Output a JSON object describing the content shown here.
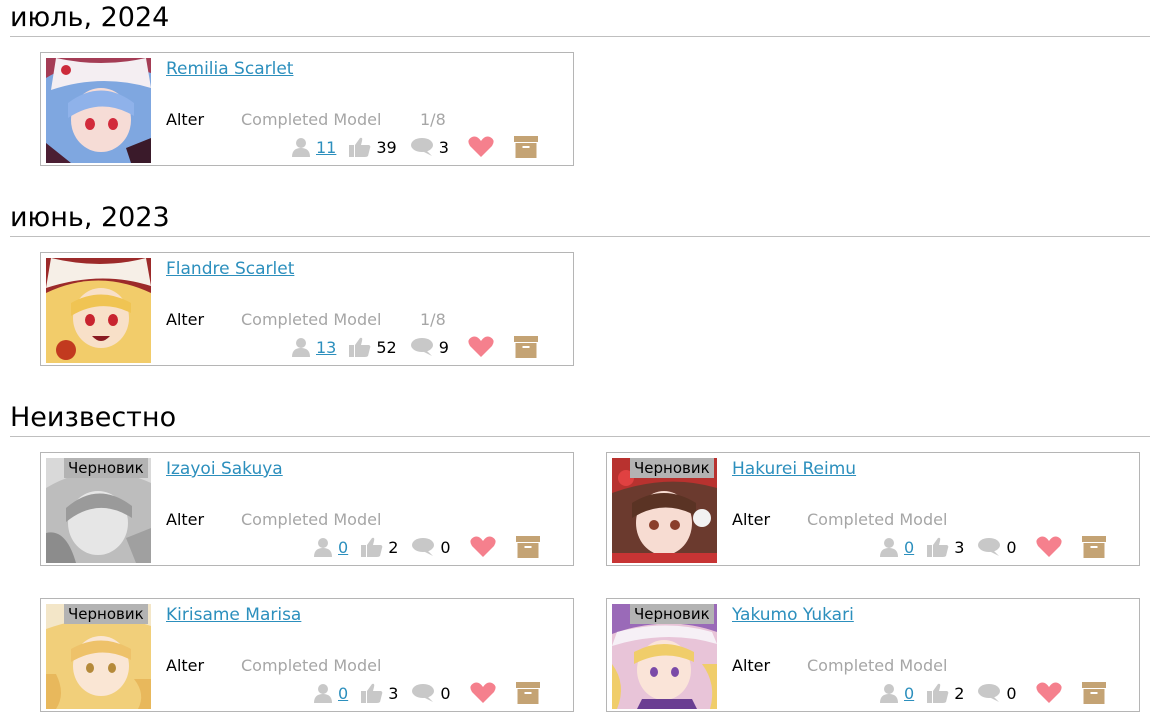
{
  "sections": [
    {
      "title": "июль, 2024"
    },
    {
      "title": "июнь, 2023"
    },
    {
      "title": "Неизвестно"
    }
  ],
  "items": [
    {
      "title": "Remilia Scarlet",
      "maker": "Alter",
      "type": "Completed Model",
      "scale": "1/8",
      "owners": "11",
      "likes": "39",
      "comments": "3",
      "draft": ""
    },
    {
      "title": "Flandre Scarlet",
      "maker": "Alter",
      "type": "Completed Model",
      "scale": "1/8",
      "owners": "13",
      "likes": "52",
      "comments": "9",
      "draft": ""
    },
    {
      "title": "Izayoi Sakuya",
      "maker": "Alter",
      "type": "Completed Model",
      "scale": "",
      "owners": "0",
      "likes": "2",
      "comments": "0",
      "draft": "Черновик"
    },
    {
      "title": "Hakurei Reimu",
      "maker": "Alter",
      "type": "Completed Model",
      "scale": "",
      "owners": "0",
      "likes": "3",
      "comments": "0",
      "draft": "Черновик"
    },
    {
      "title": "Kirisame Marisa",
      "maker": "Alter",
      "type": "Completed Model",
      "scale": "",
      "owners": "0",
      "likes": "3",
      "comments": "0",
      "draft": "Черновик"
    },
    {
      "title": "Yakumo Yukari",
      "maker": "Alter",
      "type": "Completed Model",
      "scale": "",
      "owners": "0",
      "likes": "2",
      "comments": "0",
      "draft": "Черновик"
    }
  ],
  "colors": {
    "link": "#2c8fbd",
    "heart": "#f5808d",
    "box": "#c4a374",
    "icon_gray": "#c8c8c8",
    "draft_bg": "#b3b3b3"
  },
  "icons": {
    "owners": "user-icon",
    "likes": "thumbs-up-icon",
    "comments": "comment-icon",
    "wishlist": "heart-icon",
    "collection": "archive-box-icon"
  }
}
